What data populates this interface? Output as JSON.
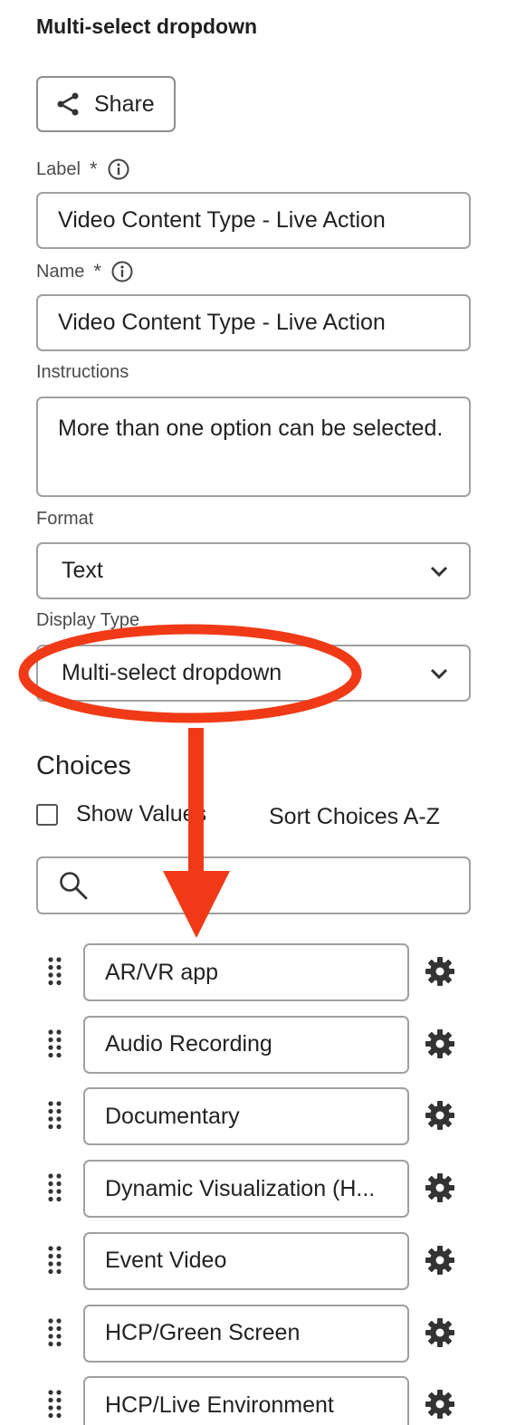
{
  "panel": {
    "title": "Multi-select dropdown",
    "share_label": "Share"
  },
  "fields": {
    "label": {
      "label": "Label",
      "required_mark": "*",
      "value": "Video Content Type - Live Action"
    },
    "name": {
      "label": "Name",
      "required_mark": "*",
      "value": "Video Content Type - Live Action"
    },
    "instructions": {
      "label": "Instructions",
      "value": "More than one option can be selected."
    },
    "format": {
      "label": "Format",
      "value": "Text"
    },
    "display_type": {
      "label": "Display Type",
      "value": "Multi-select dropdown"
    }
  },
  "choices": {
    "title": "Choices",
    "show_values_label": "Show Values",
    "sort_label": "Sort Choices A-Z",
    "search_value": "",
    "items": [
      "AR/VR app",
      "Audio Recording",
      "Documentary",
      "Dynamic Visualization (H...",
      "Event Video",
      "HCP/Green Screen",
      "HCP/Live Environment"
    ]
  },
  "icons": {
    "share": "share-icon",
    "info": "info-icon",
    "chevron": "chevron-down-icon",
    "search": "search-icon",
    "drag": "drag-handle-icon",
    "settings": "gear-icon"
  },
  "colors": {
    "annotation": "#f03a17",
    "border": "#a0a0a0",
    "text": "#222222"
  }
}
